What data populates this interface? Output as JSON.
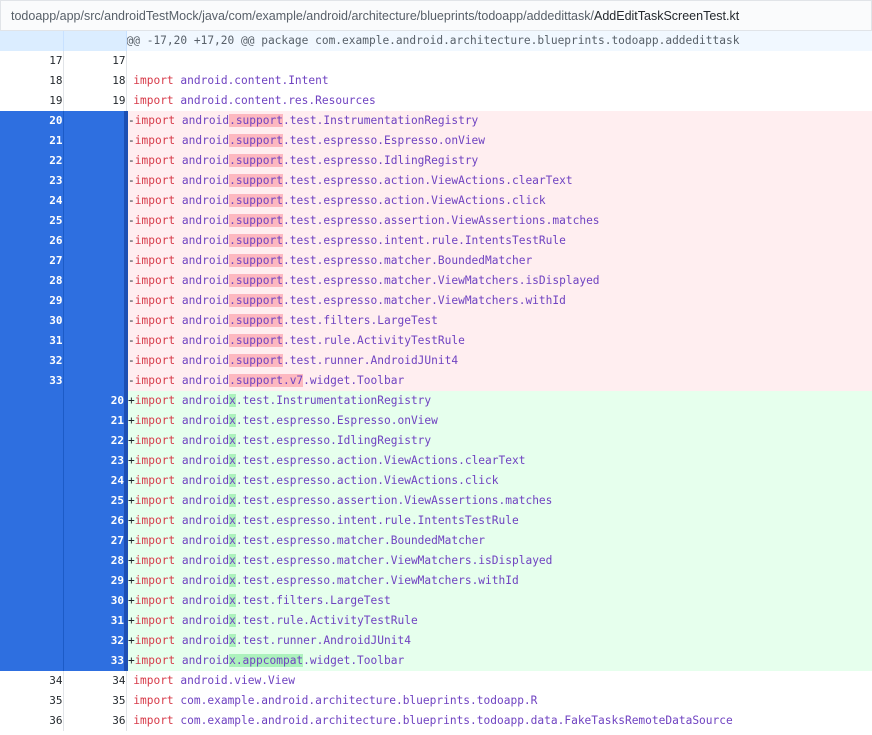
{
  "file": {
    "dir_path": "todoapp/app/src/androidTestMock/java/com/example/android/architecture/blueprints/todoapp/addedittask/",
    "name": "AddEditTaskScreenTest.kt"
  },
  "hunk_header": "@@ -17,20 +17,20 @@ package com.example.android.architecture.blueprints.todoapp.addedittask",
  "colors": {
    "selected_gutter": "#2e6fe0",
    "deleted_bg": "#ffeef0",
    "added_bg": "#e6ffed",
    "deleted_word_bg": "#fdb8c0",
    "added_word_bg": "#acf2bd",
    "keyword": "#d73a49",
    "package": "#6f42c1"
  },
  "lines": [
    {
      "type": "ctx",
      "old": "17",
      "new": "17",
      "sign": " ",
      "kw": "",
      "pre": "",
      "hl": "",
      "post": ""
    },
    {
      "type": "ctx",
      "old": "18",
      "new": "18",
      "sign": " ",
      "kw": "import",
      "pre": "android.content.Intent",
      "hl": "",
      "post": ""
    },
    {
      "type": "ctx",
      "old": "19",
      "new": "19",
      "sign": " ",
      "kw": "import",
      "pre": "android.content.res.Resources",
      "hl": "",
      "post": ""
    },
    {
      "type": "del",
      "old": "20",
      "new": "",
      "sign": "-",
      "kw": "import",
      "pre": "android",
      "hl": ".support",
      "post": ".test.InstrumentationRegistry"
    },
    {
      "type": "del",
      "old": "21",
      "new": "",
      "sign": "-",
      "kw": "import",
      "pre": "android",
      "hl": ".support",
      "post": ".test.espresso.Espresso.onView"
    },
    {
      "type": "del",
      "old": "22",
      "new": "",
      "sign": "-",
      "kw": "import",
      "pre": "android",
      "hl": ".support",
      "post": ".test.espresso.IdlingRegistry"
    },
    {
      "type": "del",
      "old": "23",
      "new": "",
      "sign": "-",
      "kw": "import",
      "pre": "android",
      "hl": ".support",
      "post": ".test.espresso.action.ViewActions.clearText"
    },
    {
      "type": "del",
      "old": "24",
      "new": "",
      "sign": "-",
      "kw": "import",
      "pre": "android",
      "hl": ".support",
      "post": ".test.espresso.action.ViewActions.click"
    },
    {
      "type": "del",
      "old": "25",
      "new": "",
      "sign": "-",
      "kw": "import",
      "pre": "android",
      "hl": ".support",
      "post": ".test.espresso.assertion.ViewAssertions.matches"
    },
    {
      "type": "del",
      "old": "26",
      "new": "",
      "sign": "-",
      "kw": "import",
      "pre": "android",
      "hl": ".support",
      "post": ".test.espresso.intent.rule.IntentsTestRule"
    },
    {
      "type": "del",
      "old": "27",
      "new": "",
      "sign": "-",
      "kw": "import",
      "pre": "android",
      "hl": ".support",
      "post": ".test.espresso.matcher.BoundedMatcher"
    },
    {
      "type": "del",
      "old": "28",
      "new": "",
      "sign": "-",
      "kw": "import",
      "pre": "android",
      "hl": ".support",
      "post": ".test.espresso.matcher.ViewMatchers.isDisplayed"
    },
    {
      "type": "del",
      "old": "29",
      "new": "",
      "sign": "-",
      "kw": "import",
      "pre": "android",
      "hl": ".support",
      "post": ".test.espresso.matcher.ViewMatchers.withId"
    },
    {
      "type": "del",
      "old": "30",
      "new": "",
      "sign": "-",
      "kw": "import",
      "pre": "android",
      "hl": ".support",
      "post": ".test.filters.LargeTest"
    },
    {
      "type": "del",
      "old": "31",
      "new": "",
      "sign": "-",
      "kw": "import",
      "pre": "android",
      "hl": ".support",
      "post": ".test.rule.ActivityTestRule"
    },
    {
      "type": "del",
      "old": "32",
      "new": "",
      "sign": "-",
      "kw": "import",
      "pre": "android",
      "hl": ".support",
      "post": ".test.runner.AndroidJUnit4"
    },
    {
      "type": "del",
      "old": "33",
      "new": "",
      "sign": "-",
      "kw": "import",
      "pre": "android",
      "hl": ".support.v7",
      "post": ".widget.Toolbar"
    },
    {
      "type": "add",
      "old": "",
      "new": "20",
      "sign": "+",
      "kw": "import",
      "pre": "android",
      "hl": "x",
      "post": ".test.InstrumentationRegistry"
    },
    {
      "type": "add",
      "old": "",
      "new": "21",
      "sign": "+",
      "kw": "import",
      "pre": "android",
      "hl": "x",
      "post": ".test.espresso.Espresso.onView"
    },
    {
      "type": "add",
      "old": "",
      "new": "22",
      "sign": "+",
      "kw": "import",
      "pre": "android",
      "hl": "x",
      "post": ".test.espresso.IdlingRegistry"
    },
    {
      "type": "add",
      "old": "",
      "new": "23",
      "sign": "+",
      "kw": "import",
      "pre": "android",
      "hl": "x",
      "post": ".test.espresso.action.ViewActions.clearText"
    },
    {
      "type": "add",
      "old": "",
      "new": "24",
      "sign": "+",
      "kw": "import",
      "pre": "android",
      "hl": "x",
      "post": ".test.espresso.action.ViewActions.click"
    },
    {
      "type": "add",
      "old": "",
      "new": "25",
      "sign": "+",
      "kw": "import",
      "pre": "android",
      "hl": "x",
      "post": ".test.espresso.assertion.ViewAssertions.matches"
    },
    {
      "type": "add",
      "old": "",
      "new": "26",
      "sign": "+",
      "kw": "import",
      "pre": "android",
      "hl": "x",
      "post": ".test.espresso.intent.rule.IntentsTestRule"
    },
    {
      "type": "add",
      "old": "",
      "new": "27",
      "sign": "+",
      "kw": "import",
      "pre": "android",
      "hl": "x",
      "post": ".test.espresso.matcher.BoundedMatcher"
    },
    {
      "type": "add",
      "old": "",
      "new": "28",
      "sign": "+",
      "kw": "import",
      "pre": "android",
      "hl": "x",
      "post": ".test.espresso.matcher.ViewMatchers.isDisplayed"
    },
    {
      "type": "add",
      "old": "",
      "new": "29",
      "sign": "+",
      "kw": "import",
      "pre": "android",
      "hl": "x",
      "post": ".test.espresso.matcher.ViewMatchers.withId"
    },
    {
      "type": "add",
      "old": "",
      "new": "30",
      "sign": "+",
      "kw": "import",
      "pre": "android",
      "hl": "x",
      "post": ".test.filters.LargeTest"
    },
    {
      "type": "add",
      "old": "",
      "new": "31",
      "sign": "+",
      "kw": "import",
      "pre": "android",
      "hl": "x",
      "post": ".test.rule.ActivityTestRule"
    },
    {
      "type": "add",
      "old": "",
      "new": "32",
      "sign": "+",
      "kw": "import",
      "pre": "android",
      "hl": "x",
      "post": ".test.runner.AndroidJUnit4"
    },
    {
      "type": "add",
      "old": "",
      "new": "33",
      "sign": "+",
      "kw": "import",
      "pre": "android",
      "hl": "x.appcompat",
      "post": ".widget.Toolbar"
    },
    {
      "type": "ctx",
      "old": "34",
      "new": "34",
      "sign": " ",
      "kw": "import",
      "pre": "android.view.View",
      "hl": "",
      "post": ""
    },
    {
      "type": "ctx",
      "old": "35",
      "new": "35",
      "sign": " ",
      "kw": "import",
      "pre": "com.example.android.architecture.blueprints.todoapp.R",
      "hl": "",
      "post": ""
    },
    {
      "type": "ctx",
      "old": "36",
      "new": "36",
      "sign": " ",
      "kw": "import",
      "pre": "com.example.android.architecture.blueprints.todoapp.data.FakeTasksRemoteDataSource",
      "hl": "",
      "post": ""
    }
  ]
}
